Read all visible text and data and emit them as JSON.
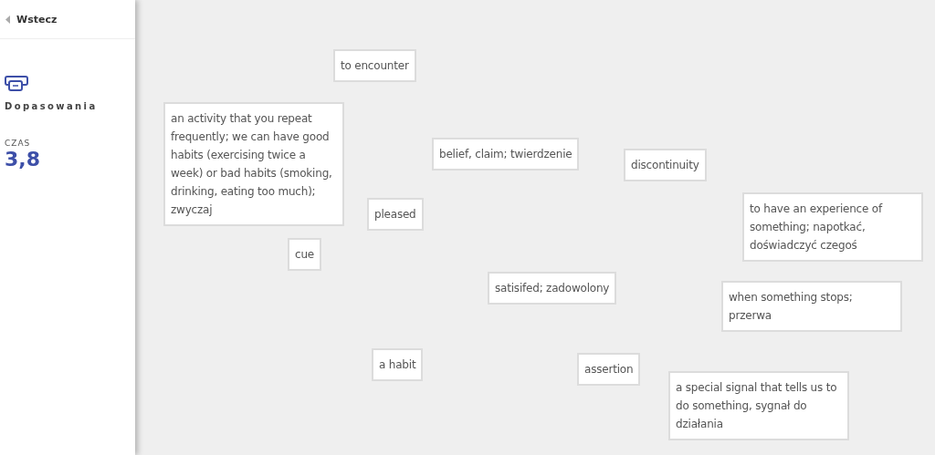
{
  "sidebar": {
    "back_link": "Wstecz",
    "mode_title": "Dopasowania",
    "timer_label": "CZAS",
    "timer_value": "3,8"
  },
  "cards": [
    {
      "text": "to encounter"
    },
    {
      "text": "an activity that you repeat frequently; we can have good habits (exercising twice a week) or bad habits (smoking, drinking, eating too much); zwyczaj"
    },
    {
      "text": "belief, claim; twierdzenie"
    },
    {
      "text": "discontinuity"
    },
    {
      "text": "pleased"
    },
    {
      "text": "to have an experience of something; napotkać, doświadczyć czegoś"
    },
    {
      "text": "cue"
    },
    {
      "text": "satisifed; zadowolony"
    },
    {
      "text": "when something stops; przerwa"
    },
    {
      "text": "a habit"
    },
    {
      "text": "assertion"
    },
    {
      "text": "a special signal that tells us to do something, sygnał do działania"
    }
  ]
}
